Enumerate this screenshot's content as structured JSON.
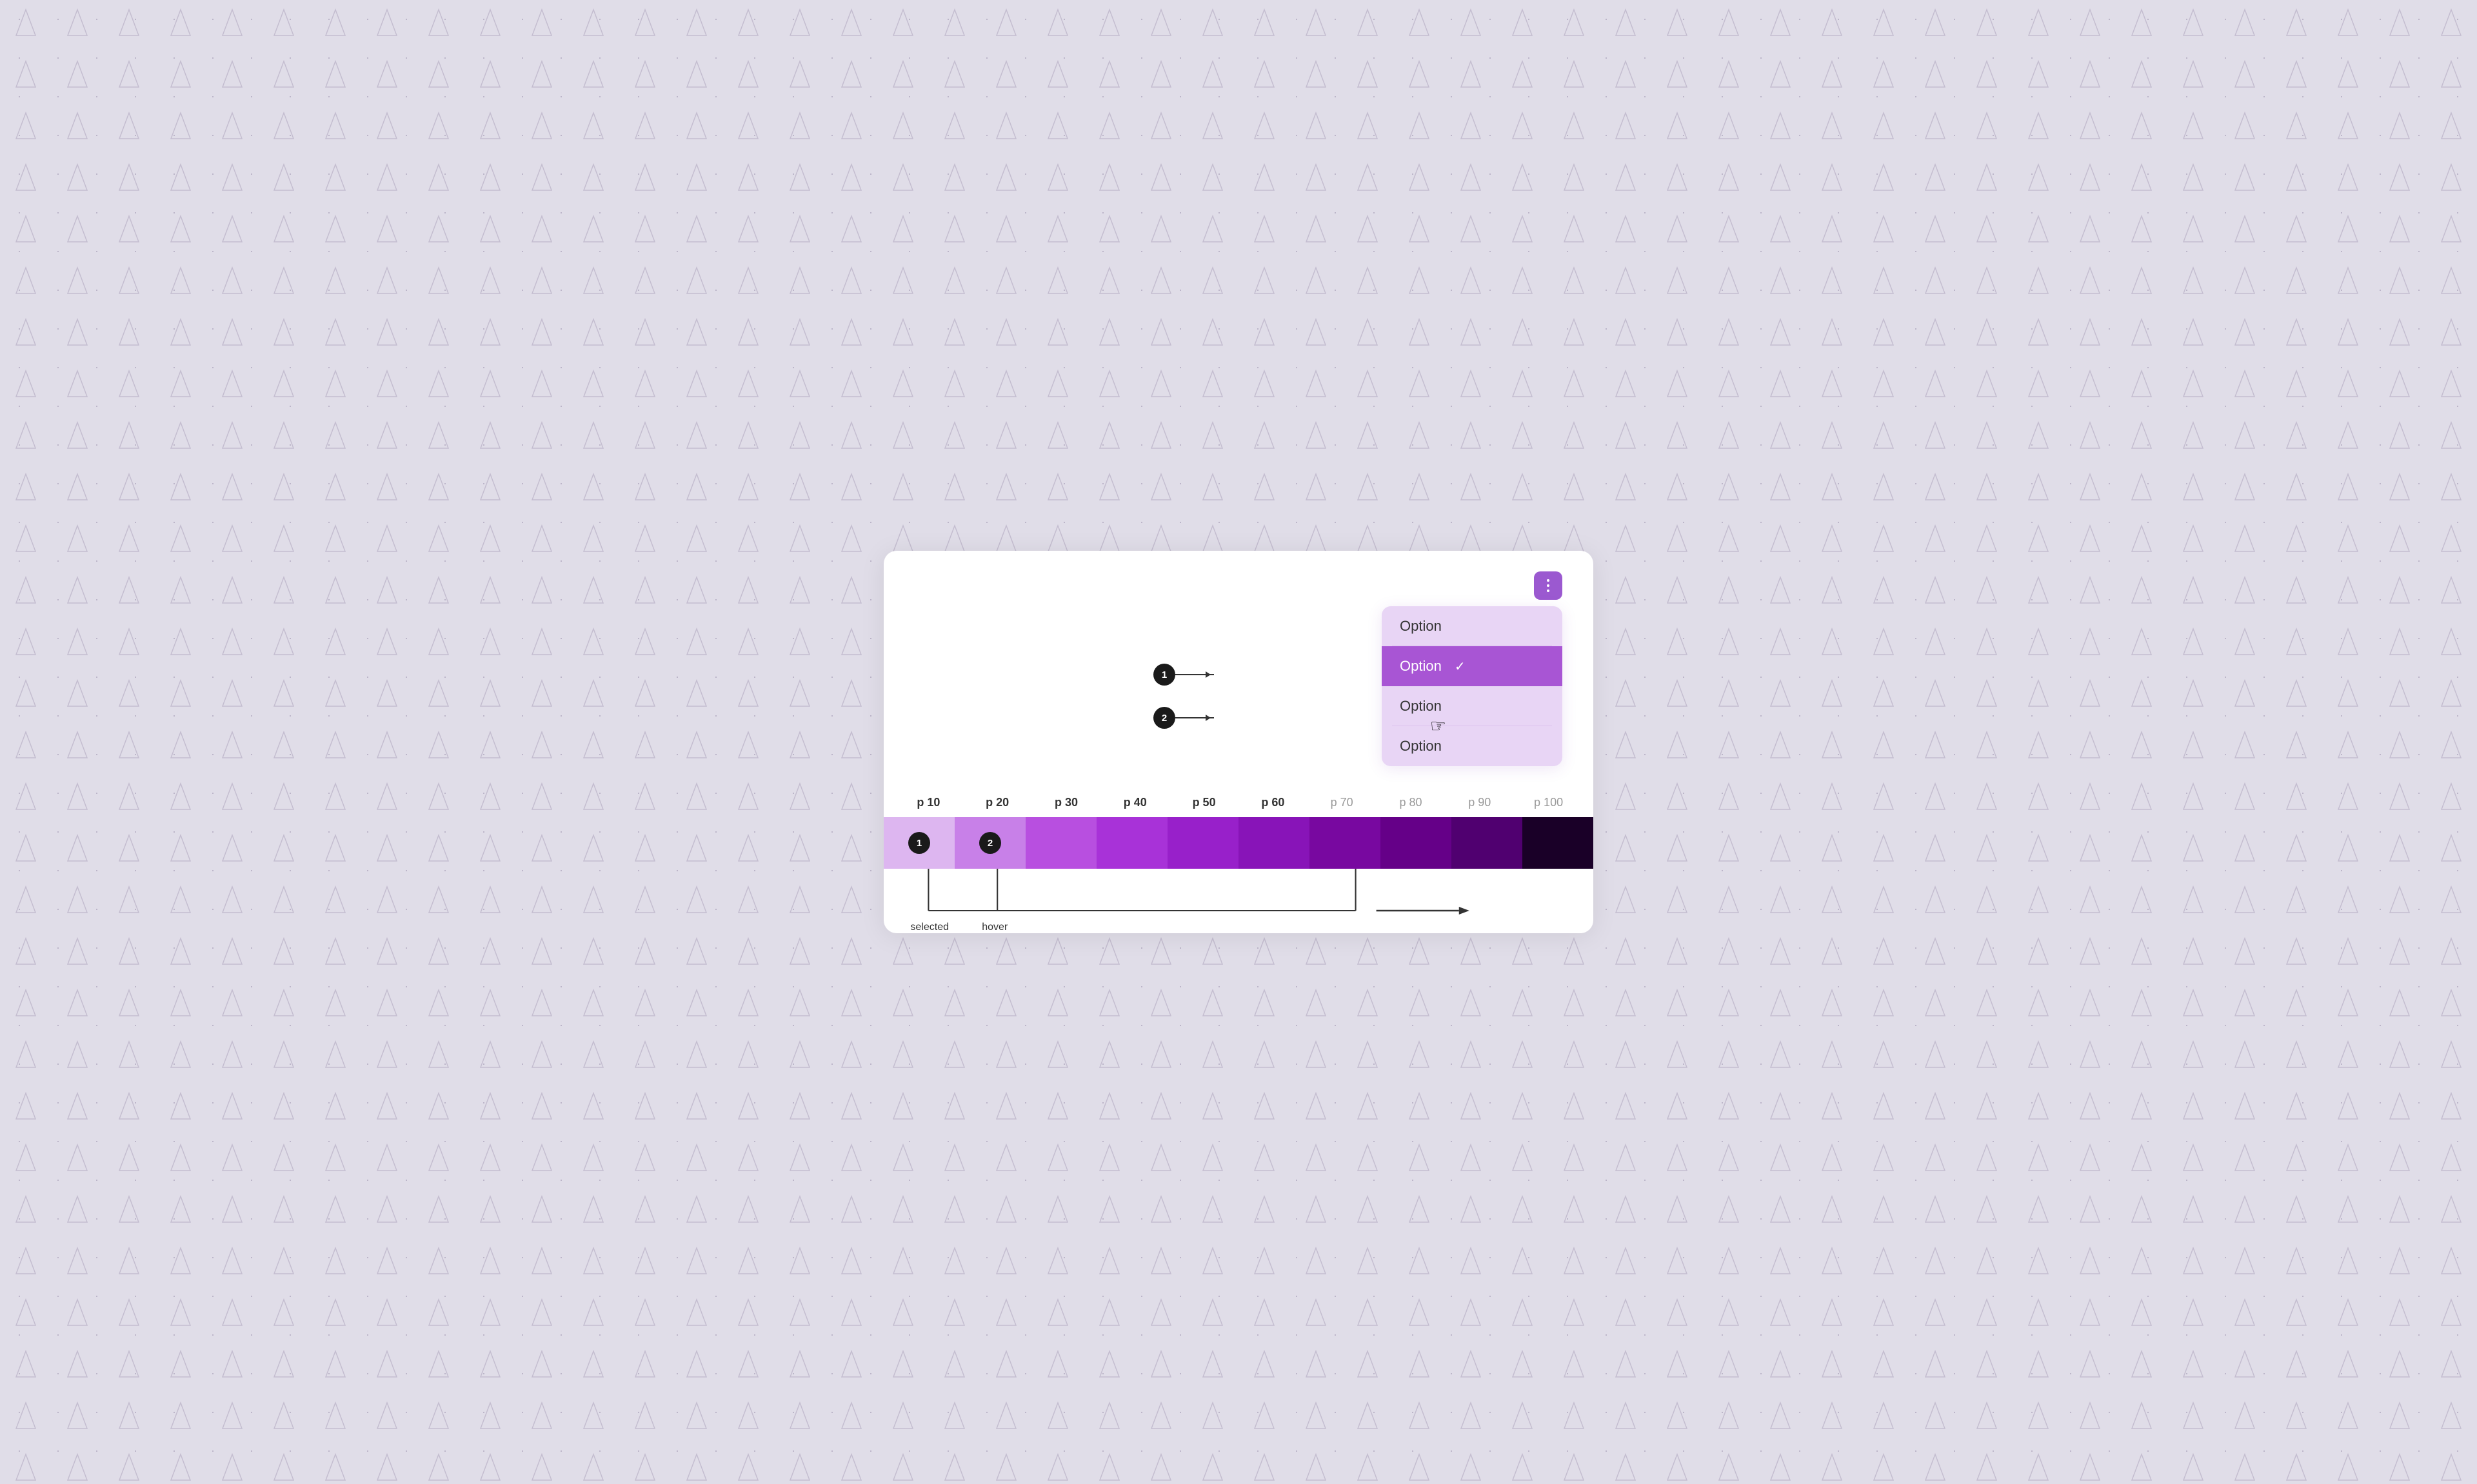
{
  "card": {
    "more_button_label": "⋮",
    "dropdown": {
      "items": [
        {
          "label": "Option",
          "selected": false,
          "id": 1
        },
        {
          "label": "Option",
          "selected": true,
          "id": 2
        },
        {
          "label": "Option",
          "selected": false,
          "id": 3
        },
        {
          "label": "Option",
          "selected": false,
          "id": 4
        }
      ],
      "check_symbol": "✓"
    },
    "annotations": [
      {
        "badge": "1",
        "target_item": 0
      },
      {
        "badge": "2",
        "target_item": 1
      }
    ]
  },
  "color_scale": {
    "labels": [
      {
        "text": "p 10",
        "active": true
      },
      {
        "text": "p 20",
        "active": true
      },
      {
        "text": "p 30",
        "active": true
      },
      {
        "text": "p 40",
        "active": true
      },
      {
        "text": "p 50",
        "active": true
      },
      {
        "text": "p 60",
        "active": true
      },
      {
        "text": "p 70",
        "active": false
      },
      {
        "text": "p 80",
        "active": false
      },
      {
        "text": "p 90",
        "active": false
      },
      {
        "text": "p 100",
        "active": false
      }
    ],
    "swatches": [
      "#ddb6f0",
      "#c880e8",
      "#b84fe0",
      "#a832d8",
      "#9820ca",
      "#8814b8",
      "#7808a0",
      "#650088",
      "#500070",
      "#1a0028"
    ],
    "badge_1": {
      "label": "1",
      "position_percent": 10
    },
    "badge_2": {
      "label": "2",
      "position_percent": 20
    },
    "annotation_selected": "selected",
    "annotation_hover": "hover",
    "bracket_left_percent": 10,
    "bracket_right_percent": 67,
    "arrow_symbol": "→"
  }
}
